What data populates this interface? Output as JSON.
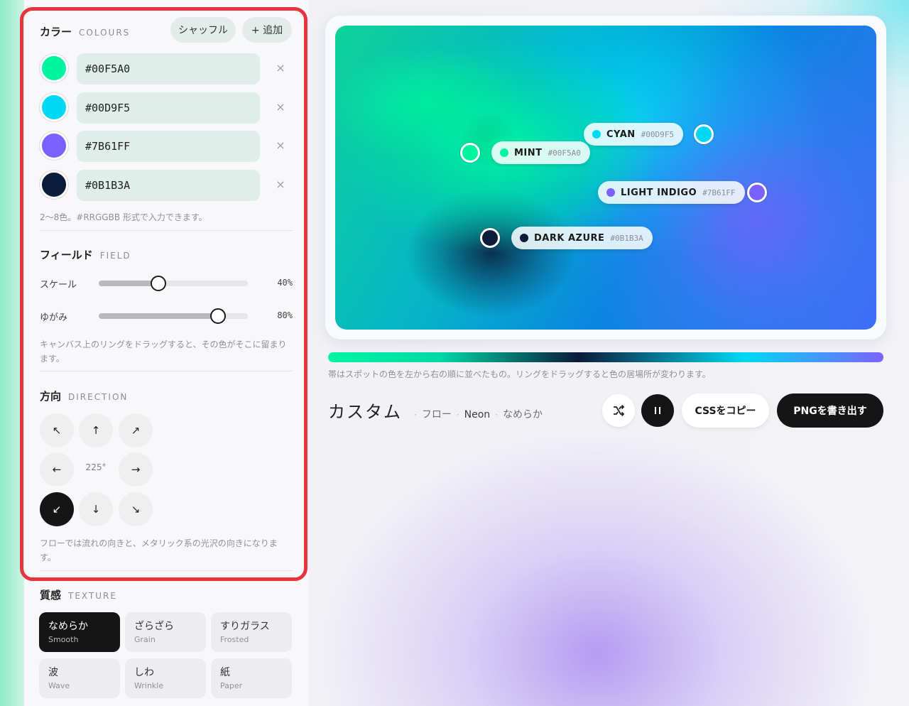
{
  "colours": {
    "title_jp": "カラー",
    "title_en": "COLOURS",
    "shuffle_label": "シャッフル",
    "add_label": "+ 追加",
    "items": [
      {
        "hex": "#00F5A0",
        "color": "#00f5a0"
      },
      {
        "hex": "#00D9F5",
        "color": "#00d9f5"
      },
      {
        "hex": "#7B61FF",
        "color": "#7b61ff"
      },
      {
        "hex": "#0B1B3A",
        "color": "#0b1b3a"
      }
    ],
    "remove_symbol": "×",
    "hint": "2〜8色。#RRGGBB 形式で入力できます。"
  },
  "field": {
    "title_jp": "フィールド",
    "title_en": "FIELD",
    "scale_label": "スケール",
    "scale_value": "40%",
    "scale_level": 0.4,
    "warp_label": "ゆがみ",
    "warp_value": "80%",
    "warp_level": 0.8,
    "hint": "キャンバス上のリングをドラッグすると、その色がそこに留まります。"
  },
  "direction": {
    "title_jp": "方向",
    "title_en": "DIRECTION",
    "arrows": {
      "nw": "↖",
      "n": "↑",
      "ne": "↗",
      "w": "←",
      "e": "→",
      "sw": "↙",
      "s": "↓",
      "se": "↘"
    },
    "angle": "225°",
    "hint": "フローでは流れの向きと、メタリック系の光沢の向きになります。"
  },
  "texture": {
    "title_jp": "質感",
    "title_en": "TEXTURE",
    "items": [
      {
        "jp": "なめらか",
        "en": "Smooth"
      },
      {
        "jp": "ざらざら",
        "en": "Grain"
      },
      {
        "jp": "すりガラス",
        "en": "Frosted"
      },
      {
        "jp": "波",
        "en": "Wave"
      },
      {
        "jp": "しわ",
        "en": "Wrinkle"
      },
      {
        "jp": "紙",
        "en": "Paper"
      }
    ]
  },
  "canvas_labels": [
    {
      "name": "CYAN",
      "code": "#00D9F5",
      "color": "#00d9f5"
    },
    {
      "name": "MINT",
      "code": "#00F5A0",
      "color": "#00f5a0"
    },
    {
      "name": "LIGHT INDIGO",
      "code": "#7B61FF",
      "color": "#7b61ff"
    },
    {
      "name": "DARK AZURE",
      "code": "#0B1B3A",
      "color": "#0b1b3a"
    }
  ],
  "strip_caption": "帯はスポットの色を左から右の順に並べたもの。リングをドラッグすると色の居場所が変わります。",
  "preset": {
    "name": "カスタム",
    "mode": "フロー",
    "palette": "Neon",
    "texture": "なめらか",
    "separator": "·"
  },
  "actions": {
    "shuffle_icon": "shuffle-icon",
    "pause_icon": "pause-icon",
    "copy_css": "CSSをコピー",
    "export_png": "PNGを書き出す"
  }
}
